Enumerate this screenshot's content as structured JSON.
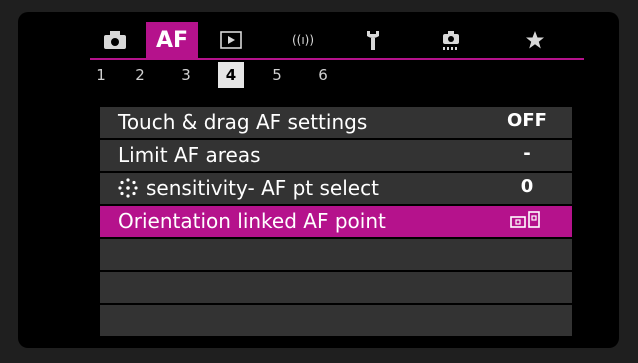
{
  "tabs": [
    {
      "name": "camera",
      "icon": "camera-icon"
    },
    {
      "name": "af",
      "label": "AF"
    },
    {
      "name": "playback",
      "icon": "playback-icon"
    },
    {
      "name": "wireless",
      "icon": "wireless-icon",
      "label": "((ı))"
    },
    {
      "name": "setup",
      "icon": "wrench-icon"
    },
    {
      "name": "custom-functions",
      "icon": "custom-function-icon"
    },
    {
      "name": "my-menu",
      "icon": "star-icon"
    }
  ],
  "subtabs": [
    "1",
    "2",
    "3",
    "4",
    "5",
    "6"
  ],
  "active_subtab": "4",
  "menu": {
    "items": [
      {
        "label": "Touch & drag AF settings",
        "value": "OFF"
      },
      {
        "label": "Limit AF areas",
        "value": "-"
      },
      {
        "label": "sensitivity- AF pt select",
        "value": "0",
        "icon": "multi-controller-icon"
      },
      {
        "label": "Orientation linked AF point",
        "value_icon": "orientation-af-point-icon",
        "selected": true
      }
    ]
  },
  "colors": {
    "accent": "#b5128c",
    "row_bg": "#333333",
    "background": "#000000"
  }
}
